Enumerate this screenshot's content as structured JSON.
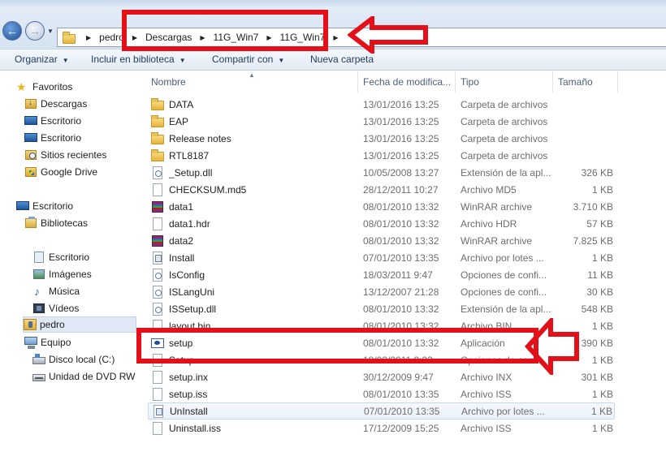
{
  "address": {
    "crumbs": [
      "pedro",
      "Descargas",
      "11G_Win7",
      "11G_Win7"
    ]
  },
  "toolbar": {
    "organize": "Organizar",
    "include_library": "Incluir en biblioteca",
    "share": "Compartir con",
    "new_folder": "Nueva carpeta"
  },
  "nav": {
    "favorites": "Favoritos",
    "downloads": "Descargas",
    "desktop_fav": "Escritorio",
    "desktop_fav2": "Escritorio",
    "recent": "Sitios recientes",
    "gdrive": "Google Drive",
    "desktop": "Escritorio",
    "libraries": "Bibliotecas",
    "lib_desktop": "Escritorio",
    "lib_images": "Imágenes",
    "lib_music": "Música",
    "lib_videos": "Vídeos",
    "user": "pedro",
    "computer": "Equipo",
    "local_disk": "Disco local (C:)",
    "dvd": "Unidad de DVD RW"
  },
  "columns": {
    "name": "Nombre",
    "date": "Fecha de modifica...",
    "type": "Tipo",
    "size": "Tamaño"
  },
  "files": [
    {
      "name": "DATA",
      "date": "13/01/2016 13:25",
      "type": "Carpeta de archivos",
      "size": "",
      "icon": "folder-icon"
    },
    {
      "name": "EAP",
      "date": "13/01/2016 13:25",
      "type": "Carpeta de archivos",
      "size": "",
      "icon": "folder-icon"
    },
    {
      "name": "Release notes",
      "date": "13/01/2016 13:25",
      "type": "Carpeta de archivos",
      "size": "",
      "icon": "folder-icon"
    },
    {
      "name": "RTL8187",
      "date": "13/01/2016 13:25",
      "type": "Carpeta de archivos",
      "size": "",
      "icon": "folder-icon"
    },
    {
      "name": "_Setup.dll",
      "date": "10/05/2008 13:27",
      "type": "Extensión de la apl...",
      "size": "326 KB",
      "icon": "dll-icon"
    },
    {
      "name": "CHECKSUM.md5",
      "date": "28/12/2011 10:27",
      "type": "Archivo MD5",
      "size": "1 KB",
      "icon": "file-icon"
    },
    {
      "name": "data1",
      "date": "08/01/2010 13:32",
      "type": "WinRAR archive",
      "size": "3.710 KB",
      "icon": "winrar-icon"
    },
    {
      "name": "data1.hdr",
      "date": "08/01/2010 13:32",
      "type": "Archivo HDR",
      "size": "57 KB",
      "icon": "file-icon"
    },
    {
      "name": "data2",
      "date": "08/01/2010 13:32",
      "type": "WinRAR archive",
      "size": "7.825 KB",
      "icon": "winrar-icon"
    },
    {
      "name": "Install",
      "date": "07/01/2010 13:35",
      "type": "Archivo por lotes ...",
      "size": "1 KB",
      "icon": "batch-icon"
    },
    {
      "name": "IsConfig",
      "date": "18/03/2011 9:47",
      "type": "Opciones de confi...",
      "size": "11 KB",
      "icon": "config-icon"
    },
    {
      "name": "ISLangUni",
      "date": "13/12/2007 21:28",
      "type": "Opciones de confi...",
      "size": "30 KB",
      "icon": "config-icon"
    },
    {
      "name": "ISSetup.dll",
      "date": "08/01/2010 13:32",
      "type": "Extensión de la apl...",
      "size": "548 KB",
      "icon": "dll-icon"
    },
    {
      "name": "layout.bin",
      "date": "08/01/2010 13:32",
      "type": "Archivo BIN",
      "size": "1 KB",
      "icon": "file-icon"
    },
    {
      "name": "setup",
      "date": "08/01/2010 13:32",
      "type": "Aplicación",
      "size": "390 KB",
      "icon": "setup-app-icon"
    },
    {
      "name": "Setup",
      "date": "18/03/2011 9:33",
      "type": "Opciones de confi...",
      "size": "1 KB",
      "icon": "file-icon"
    },
    {
      "name": "setup.inx",
      "date": "30/12/2009 9:47",
      "type": "Archivo INX",
      "size": "301 KB",
      "icon": "file-icon"
    },
    {
      "name": "setup.iss",
      "date": "08/01/2010 13:35",
      "type": "Archivo ISS",
      "size": "1 KB",
      "icon": "file-icon"
    },
    {
      "name": "UnInstall",
      "date": "07/01/2010 13:35",
      "type": "Archivo por lotes ...",
      "size": "1 KB",
      "icon": "batch-icon"
    },
    {
      "name": "Uninstall.iss",
      "date": "17/12/2009 15:25",
      "type": "Archivo ISS",
      "size": "1 KB",
      "icon": "file-icon"
    }
  ],
  "colors": {
    "annotation_red": "#e3101a",
    "toolbar_text": "#1e395b"
  }
}
